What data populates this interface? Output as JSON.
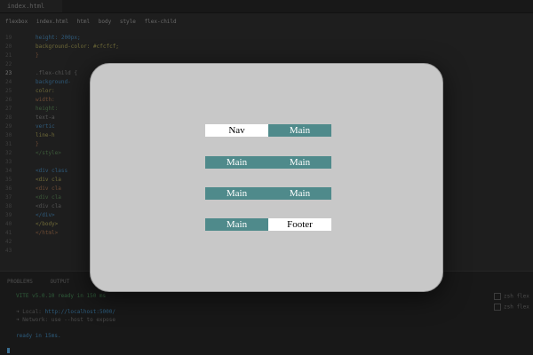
{
  "editor": {
    "tab_label": "index.html",
    "breadcrumb": [
      "flexbox",
      "index.html",
      "html",
      "body",
      "style",
      "flex-child"
    ],
    "lines": [
      {
        "num": "19",
        "code": "height: 200px;"
      },
      {
        "num": "20",
        "code": "background-color: #cfcfcf;"
      },
      {
        "num": "21",
        "code": "}"
      },
      {
        "num": "22",
        "code": ""
      },
      {
        "num": "23",
        "code": ".flex-child {"
      },
      {
        "num": "24",
        "code": "background-"
      },
      {
        "num": "25",
        "code": "color:"
      },
      {
        "num": "26",
        "code": "width:"
      },
      {
        "num": "27",
        "code": "height:"
      },
      {
        "num": "28",
        "code": "text-a"
      },
      {
        "num": "29",
        "code": "vertic"
      },
      {
        "num": "30",
        "code": "line-h"
      },
      {
        "num": "31",
        "code": "}"
      },
      {
        "num": "32",
        "code": "</style>"
      },
      {
        "num": "33",
        "code": ""
      },
      {
        "num": "34",
        "code": "<div class"
      },
      {
        "num": "35",
        "code": "<div cla"
      },
      {
        "num": "36",
        "code": "<div cla"
      },
      {
        "num": "37",
        "code": "<div cla"
      },
      {
        "num": "38",
        "code": "<div cla"
      },
      {
        "num": "39",
        "code": "</div>"
      },
      {
        "num": "40",
        "code": "</body>"
      },
      {
        "num": "41",
        "code": "</html>"
      },
      {
        "num": "42",
        "code": ""
      },
      {
        "num": "43",
        "code": ""
      }
    ],
    "active_line": "23",
    "panel_tabs": [
      "PROBLEMS",
      "OUTPUT",
      "DEBUG CONSOLE",
      "TERMINAL",
      "PORTS"
    ],
    "terminal": {
      "vite_line": "VITE v5.0.10  ready in 150 ms",
      "local_label": "➜  Local:",
      "local_url": "http://localhost:5000/",
      "network_label": "➜  Network:",
      "network_hint": "use --host to expose",
      "ready_line": "ready in 15ms."
    },
    "side_terminals": [
      "zsh  flex",
      "zsh  flex"
    ]
  },
  "preview": {
    "rows": [
      {
        "cells": [
          "Nav",
          "Main"
        ],
        "styles": [
          "white",
          "teal"
        ]
      },
      {
        "cells": [
          "Main",
          "Main"
        ],
        "styles": [
          "teal",
          "teal"
        ]
      },
      {
        "cells": [
          "Main",
          "Main"
        ],
        "styles": [
          "teal",
          "teal"
        ]
      },
      {
        "cells": [
          "Main",
          "Footer"
        ],
        "styles": [
          "teal",
          "white"
        ]
      }
    ],
    "colors": {
      "teal": "#4f8a8b",
      "white": "#ffffff",
      "container": "#c8c8c8"
    }
  }
}
